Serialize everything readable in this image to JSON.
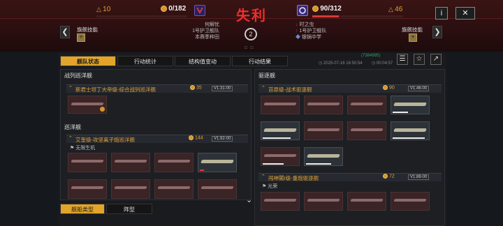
{
  "header": {
    "left_level": "10",
    "left_points": "0/182",
    "right_points": "90/312",
    "right_level": "46",
    "result": "失利",
    "flagship_skill_left": "旗舰技能",
    "flagship_skill_right": "旗舰技能",
    "left_lines": [
      "何解忧",
      "1号护卫舰队",
      "本赛季种田"
    ],
    "right_lines": [
      "时之虫",
      "1号护卫舰队",
      "银锅中学"
    ],
    "center_number": "2",
    "info_button": "i",
    "close_button": "✕",
    "prev_arrow": "❮",
    "next_arrow": "❯",
    "colors": {
      "left_emblem": "#3a2a7a",
      "right_emblem": "#5a3a9a",
      "result": "#ef2d2d",
      "accent": "#e2a52a"
    }
  },
  "tabs": [
    {
      "label": "舰队状态",
      "active": true
    },
    {
      "label": "行动统计",
      "active": false
    },
    {
      "label": "结构值变动",
      "active": false
    },
    {
      "label": "行动结果",
      "active": false
    }
  ],
  "toolbar": {
    "id_text": "(7384995)",
    "timestamp": "2025-07-16 16:50:54",
    "duration": "00:04:57",
    "icons": [
      "log-icon",
      "star-icon",
      "share-icon"
    ]
  },
  "left_panel": {
    "sections": [
      {
        "title": "战列巡洋舰",
        "ships": [
          {
            "name": "新君士坦丁大帝级-综合战列巡洋舰",
            "count": "35",
            "badge": "V1.31-00"
          }
        ]
      },
      {
        "title": "巡洋舰",
        "ships": [
          {
            "name": "艾奎级-攻坚离子炮巡洋舰",
            "count": "144",
            "badge": "V1.92-00",
            "sub": "无限生机"
          }
        ]
      }
    ],
    "bottom_tabs": [
      {
        "label": "舰船类型",
        "active": true
      },
      {
        "label": "阵型",
        "active": false
      }
    ]
  },
  "right_panel": {
    "title": "驱逐舰",
    "ships": [
      {
        "name": "苔原级-战术驱逐舰",
        "count": "90",
        "badge": "V1.46-00"
      },
      {
        "name": "闯神閣I级-重炮驱逐舰",
        "count": "72",
        "badge": "V1.88-00",
        "sub": "光荣"
      }
    ]
  },
  "scroll_hint": "⌄"
}
